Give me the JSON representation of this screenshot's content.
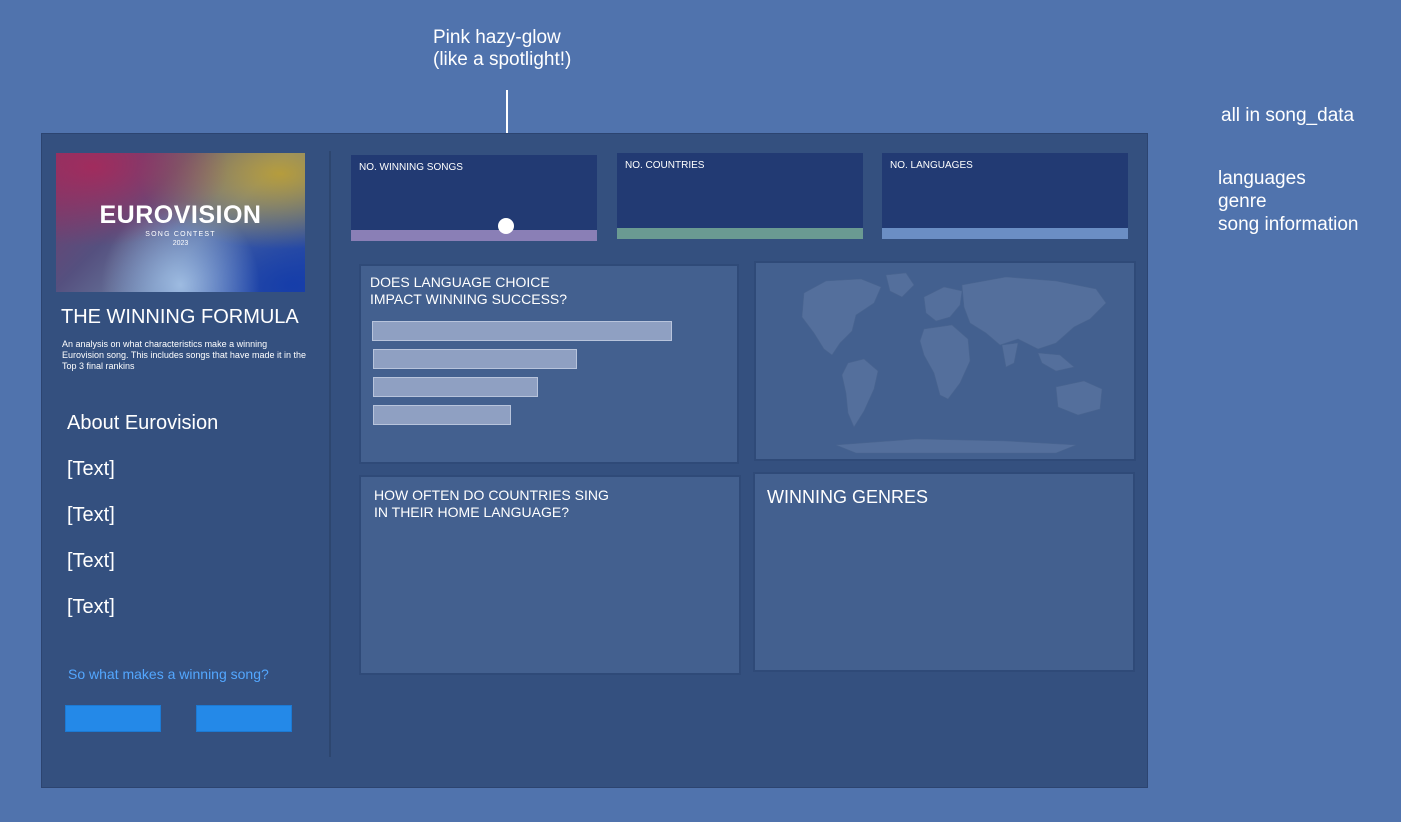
{
  "annotations": {
    "spotlight_note": [
      "Pink hazy-glow",
      "(like a spotlight!)"
    ],
    "data_source": "all in song_data",
    "data_fields": [
      "languages",
      "genre",
      "song information"
    ]
  },
  "sidebar": {
    "hero_logo_text": "EUROVISION",
    "hero_subtitle": "SONG CONTEST",
    "hero_year": "2023",
    "title": "THE WINNING FORMULA",
    "description": "An analysis on what characteristics make a winning Eurovision song. This includes songs that have made it in the Top 3 final rankins",
    "about_label": "About Eurovision",
    "nav_items": [
      "[Text]",
      "[Text]",
      "[Text]",
      "[Text]"
    ],
    "cta_text": "So what makes a winning song?",
    "button_color": "#2489e8"
  },
  "kpis": [
    {
      "label": "NO. WINNING SONGS",
      "accent": "#8a7fb6"
    },
    {
      "label": "NO. COUNTRIES",
      "accent": "#6a9a92"
    },
    {
      "label": "NO. LANGUAGES",
      "accent": "#6b8ec4"
    }
  ],
  "panels": {
    "language_success": {
      "title_lines": [
        "DOES LANGUAGE CHOICE",
        "IMPACT WINNING SUCCESS?"
      ],
      "bar_fractions": [
        1.0,
        0.68,
        0.55,
        0.46
      ]
    },
    "home_language": {
      "title_lines": [
        "HOW OFTEN DO COUNTRIES SING",
        "IN THEIR HOME LANGUAGE?"
      ]
    },
    "winning_genres": {
      "title": "WINNING GENRES"
    },
    "map": {
      "name": "world-map"
    }
  }
}
